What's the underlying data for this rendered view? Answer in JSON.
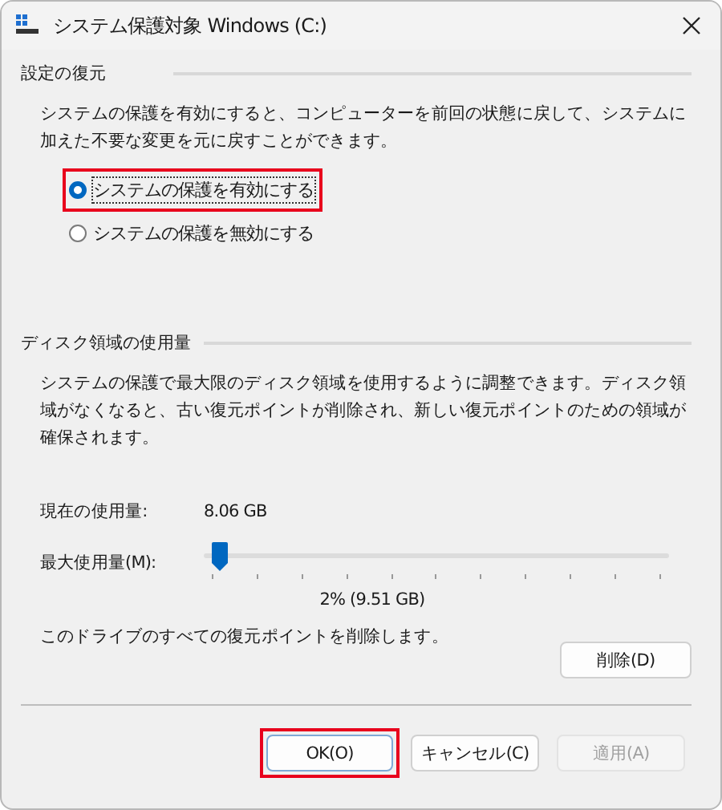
{
  "window": {
    "title": "システム保護対象 Windows (C:)"
  },
  "restore_settings": {
    "heading": "設定の復元",
    "description": "システムの保護を有効にすると、コンピューターを前回の状態に戻して、システムに加えた不要な変更を元に戻すことができます。",
    "options": [
      {
        "label": "システムの保護を有効にする",
        "selected": true,
        "highlighted": true
      },
      {
        "label": "システムの保護を無効にする",
        "selected": false,
        "highlighted": false
      }
    ]
  },
  "disk_usage": {
    "heading": "ディスク領域の使用量",
    "description": "システムの保護で最大限のディスク領域を使用するように調整できます。ディスク領域がなくなると、古い復元ポイントが削除され、新しい復元ポイントのための領域が確保されます。",
    "current_label": "現在の使用量:",
    "current_value": "8.06 GB",
    "max_label": "最大使用量(M):",
    "max_slider": {
      "level": 0.02
    },
    "max_reading": "2% (9.51 GB)",
    "delete_text": "このドライブのすべての復元ポイントを削除します。",
    "delete_button": "削除(D)"
  },
  "buttons": [
    {
      "label": "OK(O)",
      "disabled": false,
      "highlighted": true
    },
    {
      "label": "キャンセル(C)",
      "disabled": false,
      "highlighted": false
    },
    {
      "label": "適用(A)",
      "disabled": true,
      "highlighted": false
    }
  ]
}
